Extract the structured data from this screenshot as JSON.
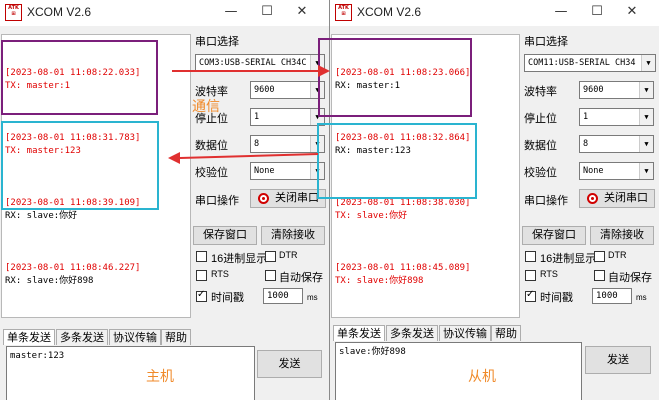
{
  "master": {
    "title": "XCOM V2.6",
    "logo": "ATK",
    "log": [
      {
        "ts": "[2023-08-01 11:08:22.033]",
        "msg": "TX: master:1",
        "color": "#e00000"
      },
      {
        "ts": "[2023-08-01 11:08:31.783]",
        "msg": "TX: master:123",
        "color": "#e00000"
      },
      {
        "ts": "[2023-08-01 11:08:39.109]",
        "msg": "RX: slave:你好",
        "color": "#000000"
      },
      {
        "ts": "[2023-08-01 11:08:46.227]",
        "msg": "RX: slave:你好898",
        "color": "#000000"
      }
    ],
    "port_label": "串口选择",
    "port_value": "COM3:USB-SERIAL CH34C",
    "baud_label": "波特率",
    "baud_value": "9600",
    "stop_label": "停止位",
    "stop_value": "1",
    "data_label": "数据位",
    "data_value": "8",
    "parity_label": "校验位",
    "parity_value": "None",
    "op_label": "串口操作",
    "op_button": "关闭串口",
    "save_button": "保存窗口",
    "clear_button": "清除接收",
    "hex_label": "16进制显示",
    "dtr_label": "DTR",
    "rts_label": "RTS",
    "autosave_label": "自动保存",
    "time_label": "时间戳",
    "time_value": "1000",
    "ms_label": "ms",
    "tabs": [
      "单条发送",
      "多条发送",
      "协议传输",
      "帮助"
    ],
    "send_text": "master:123",
    "send_button": "发送",
    "annotation": "主机"
  },
  "slave": {
    "title": "XCOM V2.6",
    "logo": "ATK",
    "log": [
      {
        "ts": "[2023-08-01 11:08:23.066]",
        "msg": "RX: master:1",
        "color": "#000000"
      },
      {
        "ts": "[2023-08-01 11:08:32.864]",
        "msg": "RX: master:123",
        "color": "#000000"
      },
      {
        "ts": "[2023-08-01 11:08:38.030]",
        "msg": "TX: slave:你好",
        "color": "#e00000"
      },
      {
        "ts": "[2023-08-01 11:08:45.089]",
        "msg": "TX: slave:你好898",
        "color": "#e00000"
      }
    ],
    "port_label": "串口选择",
    "port_value": "COM11:USB-SERIAL CH34",
    "baud_label": "波特率",
    "baud_value": "9600",
    "stop_label": "停止位",
    "stop_value": "1",
    "data_label": "数据位",
    "data_value": "8",
    "parity_label": "校验位",
    "parity_value": "None",
    "op_label": "串口操作",
    "op_button": "关闭串口",
    "save_button": "保存窗口",
    "clear_button": "清除接收",
    "hex_label": "16进制显示",
    "dtr_label": "DTR",
    "rts_label": "RTS",
    "autosave_label": "自动保存",
    "time_label": "时间戳",
    "time_value": "1000",
    "ms_label": "ms",
    "tabs": [
      "单条发送",
      "多条发送",
      "协议传输",
      "帮助"
    ],
    "send_text": "slave:你好898",
    "send_button": "发送",
    "annotation": "从机"
  },
  "annotation_comm": "通信",
  "colors": {
    "tx_box": "#7b1f7b",
    "rx_box": "#2ab4d0",
    "arrow": "#e03030",
    "timestamp": "#e00000",
    "annotation": "#f08a2a"
  }
}
